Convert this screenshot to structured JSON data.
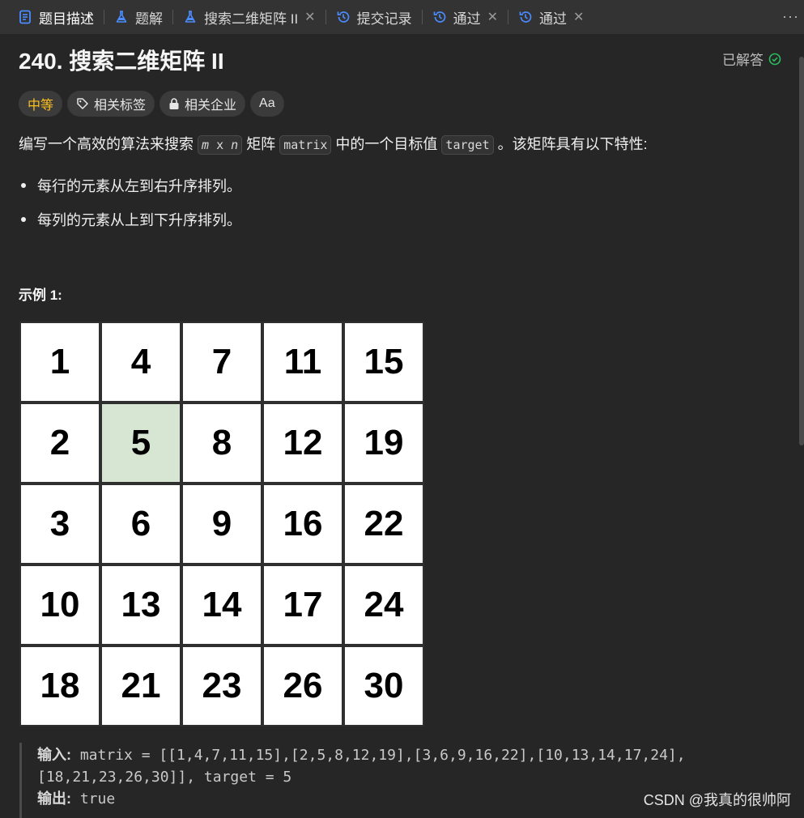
{
  "tabs": [
    {
      "label": "题目描述",
      "icon": "doc-icon",
      "active": true
    },
    {
      "label": "题解",
      "icon": "flask-icon"
    },
    {
      "label": "搜索二维矩阵 II",
      "icon": "flask-icon",
      "closable": true
    },
    {
      "label": "提交记录",
      "icon": "history-icon"
    },
    {
      "label": "通过",
      "icon": "history-icon",
      "closable": true
    },
    {
      "label": "通过",
      "icon": "history-icon",
      "closable": true
    }
  ],
  "problem": {
    "title": "240. 搜索二维矩阵 II",
    "status": "已解答",
    "difficulty": "中等",
    "tag_related": "相关标签",
    "tag_company": "相关企业",
    "tag_font": "Aa"
  },
  "description": {
    "part1": "编写一个高效的算法来搜索",
    "code_m": "m",
    "code_x": "x",
    "code_n": "n",
    "part2": "矩阵",
    "code_matrix": "matrix",
    "part3": "中的一个目标值",
    "code_target": "target",
    "part4": "。该矩阵具有以下特性:",
    "bullets": [
      "每行的元素从左到右升序排列。",
      "每列的元素从上到下升序排列。"
    ]
  },
  "example": {
    "title": "示例 1:",
    "matrix": [
      [
        "1",
        "4",
        "7",
        "11",
        "15"
      ],
      [
        "2",
        "5",
        "8",
        "12",
        "19"
      ],
      [
        "3",
        "6",
        "9",
        "16",
        "22"
      ],
      [
        "10",
        "13",
        "14",
        "17",
        "24"
      ],
      [
        "18",
        "21",
        "23",
        "26",
        "30"
      ]
    ],
    "highlight_value": "5",
    "input_label": "输入:",
    "input_line1": "matrix = [[1,4,7,11,15],[2,5,8,12,19],[3,6,9,16,22],[10,13,14,17,24],",
    "input_line2": "[18,21,23,26,30]], target = 5",
    "output_label": "输出:",
    "output_value": "true"
  },
  "watermark": "CSDN @我真的很帅阿",
  "colors": {
    "background": "#262626",
    "tabbar": "#333333",
    "difficulty": "#ffc01e",
    "solved_check": "#2cbb5d",
    "highlight_cell": "#d6e6d3"
  }
}
